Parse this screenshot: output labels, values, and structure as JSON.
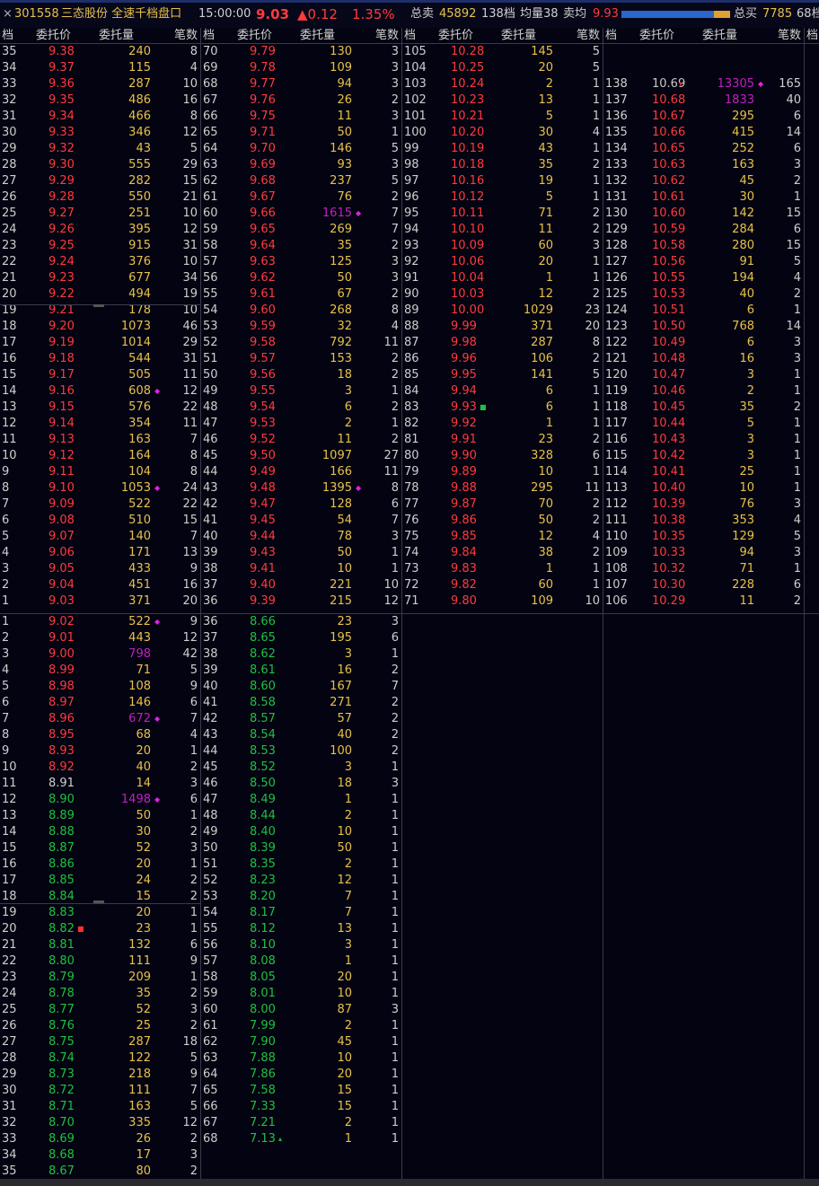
{
  "header": {
    "close_glyph": "×",
    "code": "301558",
    "title": "三态股份 全速千档盘口",
    "time": "15:00:00",
    "price": "9.03",
    "change": "▲0.12",
    "pct": "1.35%",
    "sell_total_label": "总卖",
    "sell_total": "45892",
    "sell_levels": "138档",
    "avg_label": "均量38",
    "sell_avg_label": "卖均",
    "sell_avg": "9.93",
    "buy_total_label": "总买",
    "buy_total": "7785",
    "buy_levels": "68档",
    "sell_ratio": 0.85
  },
  "columns": {
    "level": "档",
    "price": "委托价",
    "volume": "委托量",
    "count": "笔数"
  },
  "colors": {
    "up": "#ff3b3b",
    "down": "#20c040",
    "volume": "#e8c24a",
    "big_volume": "#c020c0",
    "background": "#030311"
  },
  "sell_panels": [
    [
      [
        "35",
        "9.38",
        "240",
        "8"
      ],
      [
        "34",
        "9.37",
        "115",
        "4"
      ],
      [
        "33",
        "9.36",
        "287",
        "10"
      ],
      [
        "32",
        "9.35",
        "486",
        "16"
      ],
      [
        "31",
        "9.34",
        "466",
        "8"
      ],
      [
        "30",
        "9.33",
        "346",
        "12"
      ],
      [
        "29",
        "9.32",
        "43",
        "5"
      ],
      [
        "28",
        "9.30",
        "555",
        "29"
      ],
      [
        "27",
        "9.29",
        "282",
        "15"
      ],
      [
        "26",
        "9.28",
        "550",
        "21"
      ],
      [
        "25",
        "9.27",
        "251",
        "10"
      ],
      [
        "24",
        "9.26",
        "395",
        "12"
      ],
      [
        "23",
        "9.25",
        "915",
        "31"
      ],
      [
        "22",
        "9.24",
        "376",
        "10"
      ],
      [
        "21",
        "9.23",
        "677",
        "34"
      ],
      [
        "20",
        "9.22",
        "494",
        "19"
      ],
      [
        "19",
        "9.21",
        "178",
        "10"
      ],
      [
        "18",
        "9.20",
        "1073",
        "46"
      ],
      [
        "17",
        "9.19",
        "1014",
        "29"
      ],
      [
        "16",
        "9.18",
        "544",
        "31"
      ],
      [
        "15",
        "9.17",
        "505",
        "11"
      ],
      [
        "14",
        "9.16",
        "608",
        "12",
        "diamond"
      ],
      [
        "13",
        "9.15",
        "576",
        "22"
      ],
      [
        "12",
        "9.14",
        "354",
        "11"
      ],
      [
        "11",
        "9.13",
        "163",
        "7"
      ],
      [
        "10",
        "9.12",
        "164",
        "8"
      ],
      [
        "9",
        "9.11",
        "104",
        "8"
      ],
      [
        "8",
        "9.10",
        "1053",
        "24",
        "diamond"
      ],
      [
        "7",
        "9.09",
        "522",
        "22"
      ],
      [
        "6",
        "9.08",
        "510",
        "15"
      ],
      [
        "5",
        "9.07",
        "140",
        "7"
      ],
      [
        "4",
        "9.06",
        "171",
        "13"
      ],
      [
        "3",
        "9.05",
        "433",
        "9"
      ],
      [
        "2",
        "9.04",
        "451",
        "16"
      ],
      [
        "1",
        "9.03",
        "371",
        "20"
      ]
    ],
    [
      [
        "70",
        "9.79",
        "130",
        "3"
      ],
      [
        "69",
        "9.78",
        "109",
        "3"
      ],
      [
        "68",
        "9.77",
        "94",
        "3"
      ],
      [
        "67",
        "9.76",
        "26",
        "2"
      ],
      [
        "66",
        "9.75",
        "11",
        "3"
      ],
      [
        "65",
        "9.71",
        "50",
        "1"
      ],
      [
        "64",
        "9.70",
        "146",
        "5"
      ],
      [
        "63",
        "9.69",
        "93",
        "3"
      ],
      [
        "62",
        "9.68",
        "237",
        "5"
      ],
      [
        "61",
        "9.67",
        "76",
        "2"
      ],
      [
        "60",
        "9.66",
        "1615",
        "7",
        "diamond",
        "big"
      ],
      [
        "59",
        "9.65",
        "269",
        "7"
      ],
      [
        "58",
        "9.64",
        "35",
        "2"
      ],
      [
        "57",
        "9.63",
        "125",
        "3"
      ],
      [
        "56",
        "9.62",
        "50",
        "3"
      ],
      [
        "55",
        "9.61",
        "67",
        "2"
      ],
      [
        "54",
        "9.60",
        "268",
        "8"
      ],
      [
        "53",
        "9.59",
        "32",
        "4"
      ],
      [
        "52",
        "9.58",
        "792",
        "11"
      ],
      [
        "51",
        "9.57",
        "153",
        "2"
      ],
      [
        "50",
        "9.56",
        "18",
        "2"
      ],
      [
        "49",
        "9.55",
        "3",
        "1"
      ],
      [
        "48",
        "9.54",
        "6",
        "2"
      ],
      [
        "47",
        "9.53",
        "2",
        "1"
      ],
      [
        "46",
        "9.52",
        "11",
        "2"
      ],
      [
        "45",
        "9.50",
        "1097",
        "27"
      ],
      [
        "44",
        "9.49",
        "166",
        "11"
      ],
      [
        "43",
        "9.48",
        "1395",
        "8",
        "diamond"
      ],
      [
        "42",
        "9.47",
        "128",
        "6"
      ],
      [
        "41",
        "9.45",
        "54",
        "7"
      ],
      [
        "40",
        "9.44",
        "78",
        "3"
      ],
      [
        "39",
        "9.43",
        "50",
        "1"
      ],
      [
        "38",
        "9.41",
        "10",
        "1"
      ],
      [
        "37",
        "9.40",
        "221",
        "10"
      ],
      [
        "36",
        "9.39",
        "215",
        "12"
      ]
    ],
    [
      [
        "105",
        "10.28",
        "145",
        "5"
      ],
      [
        "104",
        "10.25",
        "20",
        "5"
      ],
      [
        "103",
        "10.24",
        "2",
        "1"
      ],
      [
        "102",
        "10.23",
        "13",
        "1"
      ],
      [
        "101",
        "10.21",
        "5",
        "1"
      ],
      [
        "100",
        "10.20",
        "30",
        "4"
      ],
      [
        "99",
        "10.19",
        "43",
        "1"
      ],
      [
        "98",
        "10.18",
        "35",
        "2"
      ],
      [
        "97",
        "10.16",
        "19",
        "1"
      ],
      [
        "96",
        "10.12",
        "5",
        "1"
      ],
      [
        "95",
        "10.11",
        "71",
        "2"
      ],
      [
        "94",
        "10.10",
        "11",
        "2"
      ],
      [
        "93",
        "10.09",
        "60",
        "3"
      ],
      [
        "92",
        "10.06",
        "20",
        "1"
      ],
      [
        "91",
        "10.04",
        "1",
        "1"
      ],
      [
        "90",
        "10.03",
        "12",
        "2"
      ],
      [
        "89",
        "10.00",
        "1029",
        "23"
      ],
      [
        "88",
        "9.99",
        "371",
        "20"
      ],
      [
        "87",
        "9.98",
        "287",
        "8"
      ],
      [
        "86",
        "9.96",
        "106",
        "2"
      ],
      [
        "85",
        "9.95",
        "141",
        "5"
      ],
      [
        "84",
        "9.94",
        "6",
        "1"
      ],
      [
        "83",
        "9.93",
        "6",
        "1",
        "sq-green-price"
      ],
      [
        "82",
        "9.92",
        "1",
        "1"
      ],
      [
        "81",
        "9.91",
        "23",
        "2"
      ],
      [
        "80",
        "9.90",
        "328",
        "6"
      ],
      [
        "79",
        "9.89",
        "10",
        "1"
      ],
      [
        "78",
        "9.88",
        "295",
        "11"
      ],
      [
        "77",
        "9.87",
        "70",
        "2"
      ],
      [
        "76",
        "9.86",
        "50",
        "2"
      ],
      [
        "75",
        "9.85",
        "12",
        "4"
      ],
      [
        "74",
        "9.84",
        "38",
        "2"
      ],
      [
        "73",
        "9.83",
        "1",
        "1"
      ],
      [
        "72",
        "9.82",
        "60",
        "1"
      ],
      [
        "71",
        "9.80",
        "109",
        "10"
      ]
    ],
    [
      [],
      [],
      [
        "138",
        "10.69",
        "13305",
        "165",
        "diamond",
        "big",
        "tri-red-price"
      ],
      [
        "137",
        "10.68",
        "1833",
        "40",
        "",
        "big"
      ],
      [
        "136",
        "10.67",
        "295",
        "6"
      ],
      [
        "135",
        "10.66",
        "415",
        "14"
      ],
      [
        "134",
        "10.65",
        "252",
        "6"
      ],
      [
        "133",
        "10.63",
        "163",
        "3"
      ],
      [
        "132",
        "10.62",
        "45",
        "2"
      ],
      [
        "131",
        "10.61",
        "30",
        "1"
      ],
      [
        "130",
        "10.60",
        "142",
        "15"
      ],
      [
        "129",
        "10.59",
        "284",
        "6"
      ],
      [
        "128",
        "10.58",
        "280",
        "15"
      ],
      [
        "127",
        "10.56",
        "91",
        "5"
      ],
      [
        "126",
        "10.55",
        "194",
        "4"
      ],
      [
        "125",
        "10.53",
        "40",
        "2"
      ],
      [
        "124",
        "10.51",
        "6",
        "1"
      ],
      [
        "123",
        "10.50",
        "768",
        "14"
      ],
      [
        "122",
        "10.49",
        "6",
        "3"
      ],
      [
        "121",
        "10.48",
        "16",
        "3"
      ],
      [
        "120",
        "10.47",
        "3",
        "1"
      ],
      [
        "119",
        "10.46",
        "2",
        "1"
      ],
      [
        "118",
        "10.45",
        "35",
        "2"
      ],
      [
        "117",
        "10.44",
        "5",
        "1"
      ],
      [
        "116",
        "10.43",
        "3",
        "1"
      ],
      [
        "115",
        "10.42",
        "3",
        "1"
      ],
      [
        "114",
        "10.41",
        "25",
        "1"
      ],
      [
        "113",
        "10.40",
        "10",
        "1"
      ],
      [
        "112",
        "10.39",
        "76",
        "3"
      ],
      [
        "111",
        "10.38",
        "353",
        "4"
      ],
      [
        "110",
        "10.35",
        "129",
        "5"
      ],
      [
        "109",
        "10.33",
        "94",
        "3"
      ],
      [
        "108",
        "10.32",
        "71",
        "1"
      ],
      [
        "107",
        "10.30",
        "228",
        "6"
      ],
      [
        "106",
        "10.29",
        "11",
        "2"
      ]
    ]
  ],
  "buy_panels": [
    [
      [
        "1",
        "9.02",
        "522",
        "9",
        "diamond"
      ],
      [
        "2",
        "9.01",
        "443",
        "12"
      ],
      [
        "3",
        "9.00",
        "798",
        "42",
        "",
        "big"
      ],
      [
        "4",
        "8.99",
        "71",
        "5"
      ],
      [
        "5",
        "8.98",
        "108",
        "9"
      ],
      [
        "6",
        "8.97",
        "146",
        "6"
      ],
      [
        "7",
        "8.96",
        "672",
        "7",
        "diamond",
        "big"
      ],
      [
        "8",
        "8.95",
        "68",
        "4"
      ],
      [
        "9",
        "8.93",
        "20",
        "1"
      ],
      [
        "10",
        "8.92",
        "40",
        "2"
      ],
      [
        "11",
        "8.91",
        "14",
        "3",
        "",
        "",
        "eq"
      ],
      [
        "12",
        "8.90",
        "1498",
        "6",
        "diamond",
        "big",
        "dn"
      ],
      [
        "13",
        "8.89",
        "50",
        "1",
        "",
        "",
        "dn"
      ],
      [
        "14",
        "8.88",
        "30",
        "2",
        "",
        "",
        "dn"
      ],
      [
        "15",
        "8.87",
        "52",
        "3",
        "",
        "",
        "dn"
      ],
      [
        "16",
        "8.86",
        "20",
        "1",
        "",
        "",
        "dn"
      ],
      [
        "17",
        "8.85",
        "24",
        "2",
        "",
        "",
        "dn"
      ],
      [
        "18",
        "8.84",
        "15",
        "2",
        "",
        "",
        "dn"
      ],
      [
        "19",
        "8.83",
        "20",
        "1",
        "",
        "",
        "dn"
      ],
      [
        "20",
        "8.82",
        "23",
        "1",
        "sq-red-price",
        "",
        "dn"
      ],
      [
        "21",
        "8.81",
        "132",
        "6",
        "",
        "",
        "dn"
      ],
      [
        "22",
        "8.80",
        "111",
        "9",
        "",
        "",
        "dn"
      ],
      [
        "23",
        "8.79",
        "209",
        "1",
        "",
        "",
        "dn"
      ],
      [
        "24",
        "8.78",
        "35",
        "2",
        "",
        "",
        "dn"
      ],
      [
        "25",
        "8.77",
        "52",
        "3",
        "",
        "",
        "dn"
      ],
      [
        "26",
        "8.76",
        "25",
        "2",
        "",
        "",
        "dn"
      ],
      [
        "27",
        "8.75",
        "287",
        "18",
        "",
        "",
        "dn"
      ],
      [
        "28",
        "8.74",
        "122",
        "5",
        "",
        "",
        "dn"
      ],
      [
        "29",
        "8.73",
        "218",
        "9",
        "",
        "",
        "dn"
      ],
      [
        "30",
        "8.72",
        "111",
        "7",
        "",
        "",
        "dn"
      ],
      [
        "31",
        "8.71",
        "163",
        "5",
        "",
        "",
        "dn"
      ],
      [
        "32",
        "8.70",
        "335",
        "12",
        "",
        "",
        "dn"
      ],
      [
        "33",
        "8.69",
        "26",
        "2",
        "",
        "",
        "dn"
      ],
      [
        "34",
        "8.68",
        "17",
        "3",
        "",
        "",
        "dn"
      ],
      [
        "35",
        "8.67",
        "80",
        "2",
        "",
        "",
        "dn"
      ]
    ],
    [
      [
        "36",
        "8.66",
        "23",
        "3"
      ],
      [
        "37",
        "8.65",
        "195",
        "6"
      ],
      [
        "38",
        "8.62",
        "3",
        "1"
      ],
      [
        "39",
        "8.61",
        "16",
        "2"
      ],
      [
        "40",
        "8.60",
        "167",
        "7"
      ],
      [
        "41",
        "8.58",
        "271",
        "2"
      ],
      [
        "42",
        "8.57",
        "57",
        "2"
      ],
      [
        "43",
        "8.54",
        "40",
        "2"
      ],
      [
        "44",
        "8.53",
        "100",
        "2"
      ],
      [
        "45",
        "8.52",
        "3",
        "1"
      ],
      [
        "46",
        "8.50",
        "18",
        "3"
      ],
      [
        "47",
        "8.49",
        "1",
        "1"
      ],
      [
        "48",
        "8.44",
        "2",
        "1"
      ],
      [
        "49",
        "8.40",
        "10",
        "1"
      ],
      [
        "50",
        "8.39",
        "50",
        "1"
      ],
      [
        "51",
        "8.35",
        "2",
        "1"
      ],
      [
        "52",
        "8.23",
        "12",
        "1"
      ],
      [
        "53",
        "8.20",
        "7",
        "1"
      ],
      [
        "54",
        "8.17",
        "7",
        "1"
      ],
      [
        "55",
        "8.12",
        "13",
        "1"
      ],
      [
        "56",
        "8.10",
        "3",
        "1"
      ],
      [
        "57",
        "8.08",
        "1",
        "1"
      ],
      [
        "58",
        "8.05",
        "20",
        "1"
      ],
      [
        "59",
        "8.01",
        "10",
        "1"
      ],
      [
        "60",
        "8.00",
        "87",
        "3"
      ],
      [
        "61",
        "7.99",
        "2",
        "1"
      ],
      [
        "62",
        "7.90",
        "45",
        "1"
      ],
      [
        "63",
        "7.88",
        "10",
        "1"
      ],
      [
        "64",
        "7.86",
        "20",
        "1"
      ],
      [
        "65",
        "7.58",
        "15",
        "1"
      ],
      [
        "66",
        "7.33",
        "15",
        "1"
      ],
      [
        "67",
        "7.21",
        "2",
        "1"
      ],
      [
        "68",
        "7.13",
        "1",
        "1",
        "tri-green-price"
      ]
    ]
  ]
}
